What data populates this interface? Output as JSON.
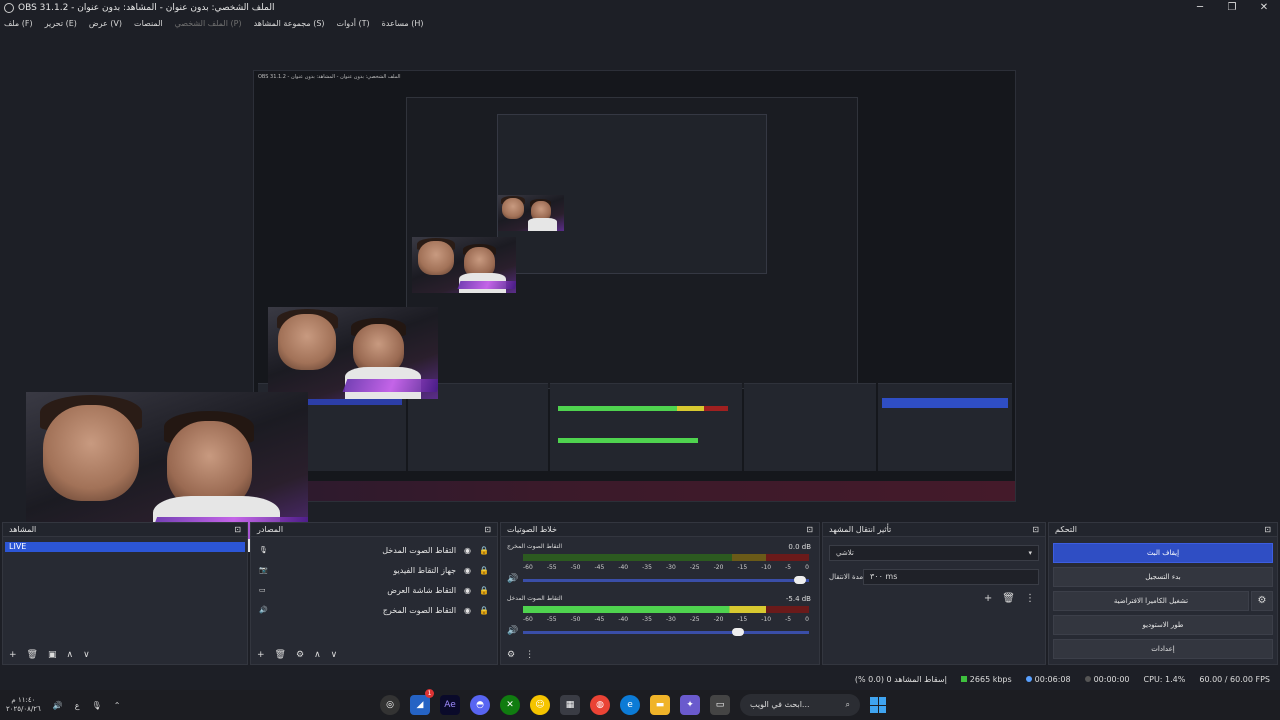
{
  "window": {
    "title": "OBS 31.1.2 - الملف الشخصي: بدون عنوان - المشاهد: بدون عنوان",
    "minimize": "─",
    "maximize": "❐",
    "close": "✕"
  },
  "menu": {
    "file": "ملف (F)",
    "edit": "تحرير (E)",
    "view": "عرض (V)",
    "docks": "المنصات",
    "profile": "الملف الشخصي (P)",
    "scene_collection": "مجموعة المشاهد (S)",
    "tools": "أدوات (T)",
    "help": "مساعدة (H)"
  },
  "live_label": "LIVE",
  "sources": {
    "title": "المصادر",
    "items": [
      {
        "label": "التقاط الصوت المدخل",
        "icon": "microphone-icon"
      },
      {
        "label": "جهاز التقاط الفيديو",
        "icon": "camera-icon"
      },
      {
        "label": "التقاط شاشة العرض",
        "icon": "monitor-icon"
      },
      {
        "label": "التقاط الصوت المخرج",
        "icon": "speaker-icon"
      }
    ]
  },
  "mixer": {
    "title": "خلاط الصوتيات",
    "ticks": [
      "-60",
      "-55",
      "-50",
      "-45",
      "-40",
      "-35",
      "-30",
      "-25",
      "-20",
      "-15",
      "-10",
      "-5",
      "0"
    ],
    "tracks": [
      {
        "name": "التقاط الصوت المخرج",
        "db": "0.0 dB",
        "level": 0.0,
        "volume": 0.97
      },
      {
        "name": "التقاط الصوت المدخل",
        "db": "-5.4 dB",
        "level": 0.85,
        "volume": 0.75
      }
    ]
  },
  "transitions": {
    "title": "تأثير انتقال المشهد",
    "selected": "تلاشي",
    "duration_label": "مدة الانتقال",
    "duration_value": "٣٠٠ ms"
  },
  "controls": {
    "title": "التحكم",
    "stop_stream": "إيقاف البث",
    "start_recording": "بدء التسجيل",
    "virtual_camera": "تشغيل الكاميرا الافتراضية",
    "studio_mode": "طور الاستوديو",
    "settings": "إعدادات"
  },
  "status": {
    "dropped": "إسقاط المشاهد 0 (0.0 %)",
    "bitrate": "2665 kbps",
    "stream_time": "00:06:08",
    "rec_time": "00:00:00",
    "cpu": "CPU: 1.4%",
    "fps": "60.00 / 60.00 FPS"
  },
  "taskbar": {
    "clock_time": "١١:٤٠ م",
    "clock_date": "٢٠٢٥/٠٨/٢٦",
    "lang": "ع",
    "search_placeholder": "ابحث في الويب...",
    "notification_count": "1"
  },
  "nested": {
    "title": "OBS 31.1.2 - الملف الشخصي: بدون عنوان - المشاهد: بدون عنوان"
  },
  "colors": {
    "accent": "#2f4ec4",
    "meter_green": "#4fd34f",
    "background": "#1d1f26"
  }
}
